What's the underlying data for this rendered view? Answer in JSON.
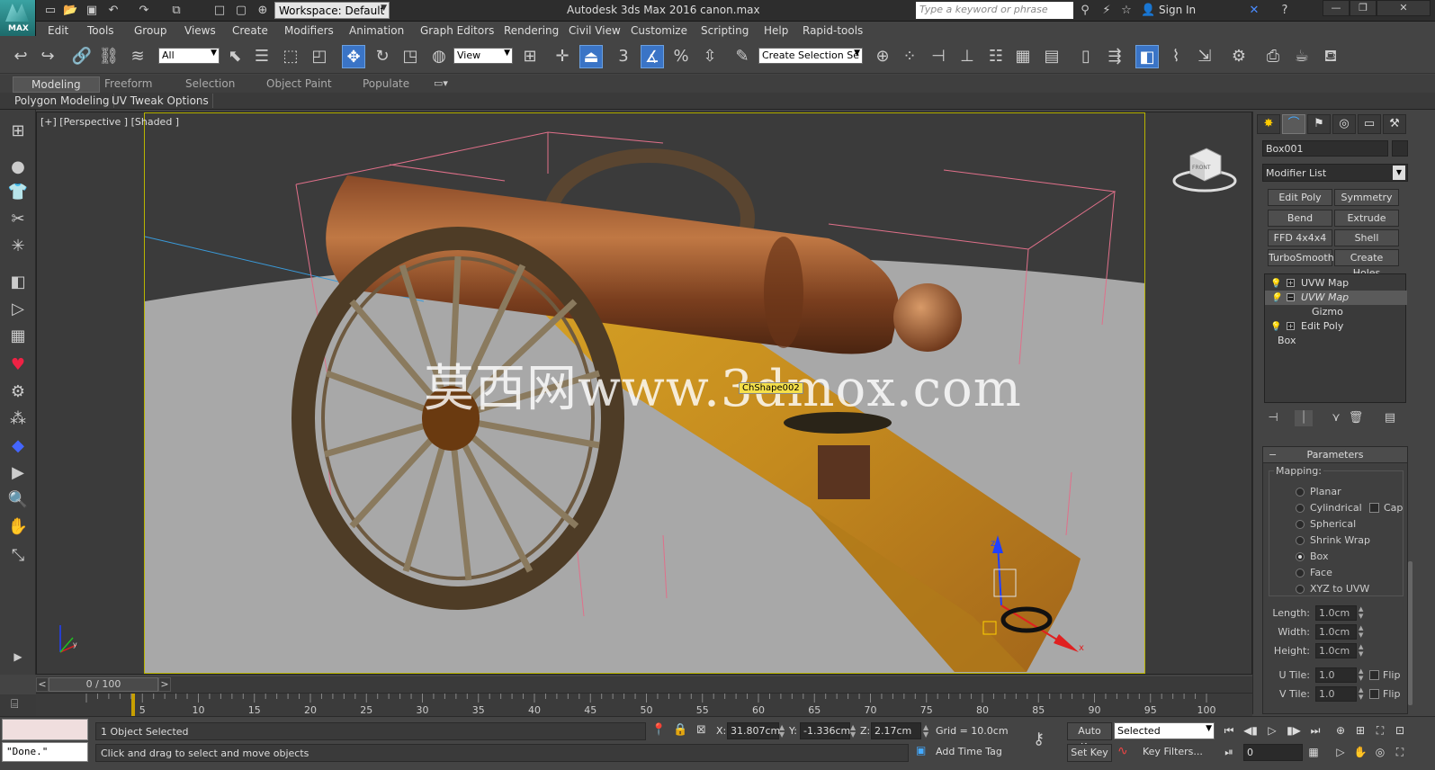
{
  "titlebar": {
    "app_logo_text": "MAX",
    "workspace": "Workspace: Default",
    "app_title": "Autodesk 3ds Max 2016     canon.max",
    "search_placeholder": "Type a keyword or phrase",
    "sign_in": "Sign In"
  },
  "menu": [
    "Edit",
    "Tools",
    "Group",
    "Views",
    "Create",
    "Modifiers",
    "Animation",
    "Graph Editors",
    "Rendering",
    "Civil View",
    "Customize",
    "Scripting",
    "Help",
    "Rapid-tools"
  ],
  "toolbar": {
    "selection_filter": "All",
    "ref_coord": "View",
    "named_selection": "Create Selection Se",
    "snap_label": "3"
  },
  "ribbon": {
    "tabs": [
      "Modeling",
      "Freeform",
      "Selection",
      "Object Paint",
      "Populate"
    ],
    "active_tab": "Modeling",
    "subtabs": [
      "Polygon Modeling",
      "UV Tweak Options"
    ]
  },
  "viewport": {
    "label": "[+] [Perspective ] [Shaded ]",
    "watermark": "莫西网www.3dmox.com",
    "tooltip": "ChShape002",
    "viewcube_label": "FRONT",
    "axis_x": "x",
    "axis_y": "y",
    "axis_z": "z"
  },
  "command_panel": {
    "object_name": "Box001",
    "modifier_list": "Modifier List",
    "modifier_buttons": [
      "Edit Poly",
      "Symmetry",
      "Bend",
      "Extrude",
      "FFD 4x4x4",
      "Shell",
      "TurboSmooth",
      "Create Holes"
    ],
    "stack": [
      {
        "label": "UVW Map",
        "eye": true,
        "expand": "+",
        "selected": false
      },
      {
        "label": "UVW Map",
        "eye": true,
        "expand": "−",
        "selected": true
      },
      {
        "label": "Gizmo",
        "eye": false,
        "expand": "",
        "selected": false
      },
      {
        "label": "Edit Poly",
        "eye": true,
        "expand": "+",
        "selected": false
      },
      {
        "label": "Box",
        "eye": false,
        "expand": "",
        "selected": false
      }
    ],
    "params_title": "Parameters",
    "mapping_title": "Mapping:",
    "mapping_options": [
      "Planar",
      "Cylindrical",
      "Spherical",
      "Shrink Wrap",
      "Box",
      "Face",
      "XYZ to UVW"
    ],
    "mapping_selected": "Box",
    "cap_label": "Cap",
    "length_label": "Length:",
    "length_value": "1.0cm",
    "width_label": "Width:",
    "width_value": "1.0cm",
    "height_label": "Height:",
    "height_value": "1.0cm",
    "utile_label": "U Tile:",
    "utile_value": "1.0",
    "vtile_label": "V Tile:",
    "vtile_value": "1.0",
    "flip_label": "Flip"
  },
  "timeline": {
    "slider_text": "0 / 100",
    "prev": "<",
    "next": ">",
    "ticks": [
      "5",
      "10",
      "15",
      "20",
      "25",
      "30",
      "35",
      "40",
      "45",
      "50",
      "55",
      "60",
      "65",
      "70",
      "75",
      "80",
      "85",
      "90",
      "95",
      "100"
    ]
  },
  "status": {
    "maxscript_output": "\"Done.\"",
    "selection_info": "1 Object Selected",
    "prompt": "Click and drag to select and move objects",
    "x_label": "X:",
    "x_value": "31.807cm",
    "y_label": "Y:",
    "y_value": "-1.336cm",
    "z_label": "Z:",
    "z_value": "2.17cm",
    "grid": "Grid = 10.0cm",
    "add_time_tag": "Add Time Tag",
    "auto_key": "Auto Key",
    "set_key": "Set Key",
    "key_mode": "Selected",
    "key_filters": "Key Filters...",
    "current_frame": "0"
  }
}
